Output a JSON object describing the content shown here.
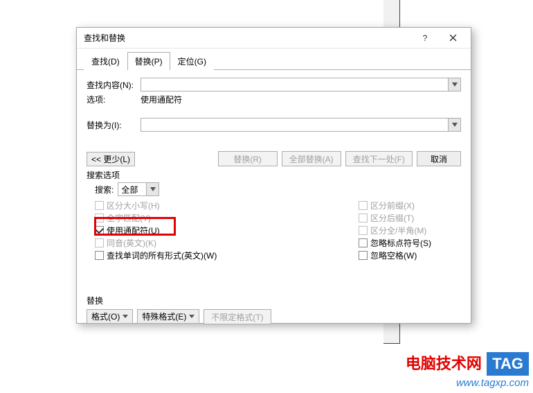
{
  "dialog": {
    "title": "查找和替换",
    "tabs": {
      "find": "查找(D)",
      "replace": "替换(P)",
      "goto": "定位(G)"
    },
    "find_label": "查找内容(N):",
    "find_value": "",
    "option_label": "选项:",
    "option_value": "使用通配符",
    "replace_label": "替换为(I):",
    "replace_value": "",
    "buttons": {
      "less": "<< 更少(L)",
      "replace": "替换(R)",
      "replace_all": "全部替换(A)",
      "find_next": "查找下一处(F)",
      "cancel": "取消"
    },
    "search_options_label": "搜索选项",
    "search_label": "搜索:",
    "search_scope_value": "全部",
    "checks_left": {
      "case": "区分大小写(H)",
      "whole": "全字匹配(Y)",
      "wildcard": "使用通配符(U)",
      "sounds": "同音(英文)(K)",
      "forms": "查找单词的所有形式(英文)(W)"
    },
    "checks_right": {
      "prefix": "区分前缀(X)",
      "suffix": "区分后缀(T)",
      "fullhalf": "区分全/半角(M)",
      "punct": "忽略标点符号(S)",
      "space": "忽略空格(W)"
    },
    "replace_section": "替换",
    "format_btn": "格式(O)",
    "special_btn": "特殊格式(E)",
    "noformat_btn": "不限定格式(T)"
  },
  "watermark": {
    "text": "电脑技术网",
    "tag": "TAG",
    "url": "www.tagxp.com"
  }
}
